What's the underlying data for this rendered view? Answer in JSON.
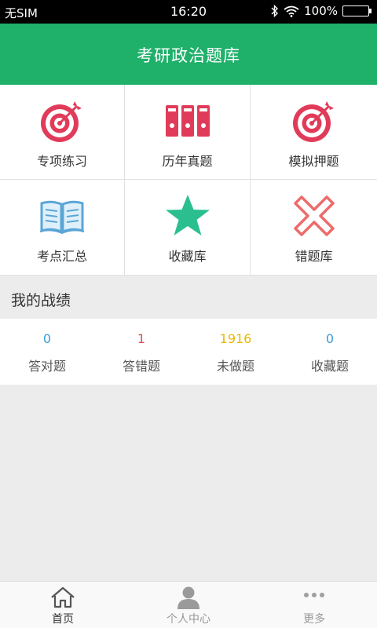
{
  "status_bar": {
    "carrier": "无SIM",
    "time": "16:20",
    "battery": "100%"
  },
  "header": {
    "title": "考研政治题库"
  },
  "grid": {
    "items": [
      {
        "label": "专项练习",
        "icon": "target-icon",
        "color": "#e13b5a"
      },
      {
        "label": "历年真题",
        "icon": "binders-icon",
        "color": "#e13b5a"
      },
      {
        "label": "模拟押题",
        "icon": "target-icon",
        "color": "#e13b5a"
      },
      {
        "label": "考点汇总",
        "icon": "book-icon",
        "color": "#5aa6d6"
      },
      {
        "label": "收藏库",
        "icon": "star-icon",
        "color": "#2bbf90"
      },
      {
        "label": "错题库",
        "icon": "cross-icon",
        "color": "#ee6b6b"
      }
    ]
  },
  "stats": {
    "title": "我的战绩",
    "items": [
      {
        "value": "0",
        "label": "答对题",
        "color": "#3a9bd6"
      },
      {
        "value": "1",
        "label": "答错题",
        "color": "#e74c5a"
      },
      {
        "value": "1916",
        "label": "未做题",
        "color": "#e6b800"
      },
      {
        "value": "0",
        "label": "收藏题",
        "color": "#3a9bd6"
      }
    ]
  },
  "tab_bar": {
    "items": [
      {
        "label": "首页",
        "icon": "home-icon",
        "active": true
      },
      {
        "label": "个人中心",
        "icon": "person-icon",
        "active": false
      },
      {
        "label": "更多",
        "icon": "more-icon",
        "active": false
      }
    ]
  }
}
